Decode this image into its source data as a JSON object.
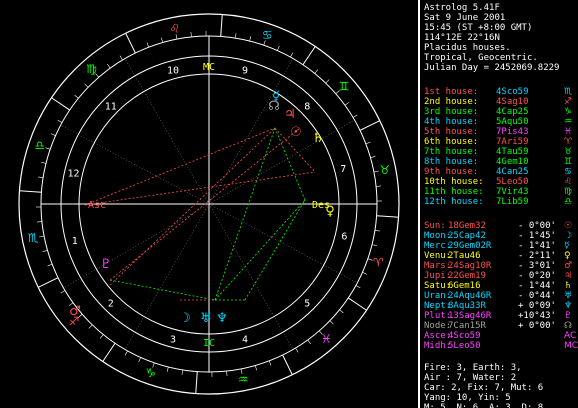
{
  "colors": {
    "background": "#000000",
    "foreground": "#ffffff",
    "red": "#ff5050",
    "green": "#00ff00",
    "cyan": "#00d8ff",
    "yellow": "#ffff00",
    "magenta": "#ff40ff",
    "blue": "#6060ff",
    "gray": "#a0a0a0"
  },
  "header": [
    "Astrolog 5.41F",
    "Sat 9 June 2001",
    "15:45 (ST +8:00 GMT)",
    "114°12E 22°16N",
    "Placidus houses.",
    "Tropical, Geocentric.",
    "Julian Day = 2452069.8229"
  ],
  "houses": [
    {
      "name": "1st house:",
      "value": "4Sco59",
      "name_color": "#ff5050",
      "val_color": "#00d8ff",
      "glyph": "scorpio-glyph",
      "glyph_color": "#00d8ff"
    },
    {
      "name": "2nd house:",
      "value": "4Sag10",
      "name_color": "#ffff00",
      "val_color": "#ff5050",
      "glyph": "sagittarius-glyph",
      "glyph_color": "#ff5050"
    },
    {
      "name": "3rd house:",
      "value": "4Cap25",
      "name_color": "#00ff00",
      "val_color": "#00ff00",
      "glyph": "capricorn-glyph",
      "glyph_color": "#00ff00"
    },
    {
      "name": "4th house:",
      "value": "5Aqu50",
      "name_color": "#00d8ff",
      "val_color": "#00ff00",
      "glyph": "aquarius-glyph",
      "glyph_color": "#00ff00"
    },
    {
      "name": "5th house:",
      "value": "7Pis43",
      "name_color": "#ff5050",
      "val_color": "#ff40ff",
      "glyph": "pisces-glyph",
      "glyph_color": "#ff40ff"
    },
    {
      "name": "6th house:",
      "value": "7Ari59",
      "name_color": "#ffff00",
      "val_color": "#ff5050",
      "glyph": "aries-glyph",
      "glyph_color": "#ff5050"
    },
    {
      "name": "7th house:",
      "value": "4Tau59",
      "name_color": "#00ff00",
      "val_color": "#00ff00",
      "glyph": "taurus-glyph",
      "glyph_color": "#00ff00"
    },
    {
      "name": "8th house:",
      "value": "4Gem10",
      "name_color": "#00d8ff",
      "val_color": "#00ff00",
      "glyph": "gemini-glyph",
      "glyph_color": "#00ff00"
    },
    {
      "name": "9th house:",
      "value": "4Can25",
      "name_color": "#ff5050",
      "val_color": "#00d8ff",
      "glyph": "cancer-glyph",
      "glyph_color": "#00d8ff"
    },
    {
      "name": "10th house:",
      "value": "5Leo50",
      "name_color": "#ffff00",
      "val_color": "#ff5050",
      "glyph": "leo-glyph",
      "glyph_color": "#ff5050"
    },
    {
      "name": "11th house:",
      "value": "7Vir43",
      "name_color": "#00ff00",
      "val_color": "#00ff00",
      "glyph": "virgo-glyph",
      "glyph_color": "#00ff00"
    },
    {
      "name": "12th house:",
      "value": "7Lib59",
      "name_color": "#00d8ff",
      "val_color": "#00ff00",
      "glyph": "libra-glyph",
      "glyph_color": "#00ff00"
    }
  ],
  "planets": [
    {
      "name": "Sun:",
      "pos": "18Gem32",
      "lat": "- 0°00'",
      "color": "#ff5050",
      "glyph": "sun-glyph"
    },
    {
      "name": "Moon:",
      "pos": "25Cap42",
      "lat": "- 1°45'",
      "color": "#00d8ff",
      "glyph": "moon-glyph"
    },
    {
      "name": "Merc:",
      "pos": "29Gem02R",
      "lat": "- 1°41'",
      "color": "#00d8ff",
      "glyph": "mercury-glyph"
    },
    {
      "name": "Venu:",
      "pos": "2Tau46",
      "lat": "- 2°11'",
      "color": "#ffff00",
      "glyph": "venus-glyph"
    },
    {
      "name": "Mars:",
      "pos": "24Sag10R",
      "lat": "- 3°01'",
      "color": "#ff5050",
      "glyph": "mars-glyph"
    },
    {
      "name": "Jupi:",
      "pos": "22Gem19",
      "lat": "- 0°20'",
      "color": "#ff5050",
      "glyph": "jupiter-glyph"
    },
    {
      "name": "Satu:",
      "pos": "6Gem16",
      "lat": "- 1°44'",
      "color": "#ffff00",
      "glyph": "saturn-glyph"
    },
    {
      "name": "Uran:",
      "pos": "24Aqu46R",
      "lat": "- 0°44'",
      "color": "#00d8ff",
      "glyph": "uranus-glyph"
    },
    {
      "name": "Nept:",
      "pos": "8Aqu33R",
      "lat": "+ 0°09'",
      "color": "#00d8ff",
      "glyph": "neptune-glyph"
    },
    {
      "name": "Plut:",
      "pos": "13Sag46R",
      "lat": "+10°43'",
      "color": "#ff40ff",
      "glyph": "pluto-glyph"
    },
    {
      "name": "Node:",
      "pos": "7Can15R",
      "lat": "+ 0°00'",
      "color": "#a0a0a0",
      "glyph": "node-glyph"
    },
    {
      "name": "Asce:",
      "pos": "4Sco59",
      "lat": "",
      "color": "#ff40ff",
      "glyph": "ascendant-glyph"
    },
    {
      "name": "Midh:",
      "pos": "5Leo50",
      "lat": "",
      "color": "#ff40ff",
      "glyph": "midheaven-glyph"
    }
  ],
  "summary": [
    "Fire: 3, Earth: 3,",
    "Air : 7, Water: 2",
    "Car: 2, Fix: 7, Mut: 6",
    "Yang: 10, Yin: 5",
    "M: 5, N: 6, A: 3, D: 8"
  ],
  "wheel": {
    "house_numbers": [
      "1",
      "2",
      "3",
      "4",
      "5",
      "6",
      "7",
      "8",
      "9",
      "10",
      "11",
      "12"
    ],
    "angle_labels": {
      "asc": "Asc",
      "desc": "Des",
      "mc": "MC",
      "ic": "IC"
    },
    "sign_glyphs": [
      "♏",
      "♐",
      "♑",
      "♒",
      "♓",
      "♈",
      "♉",
      "♊",
      "♋",
      "♌",
      "♍",
      "♎"
    ]
  }
}
